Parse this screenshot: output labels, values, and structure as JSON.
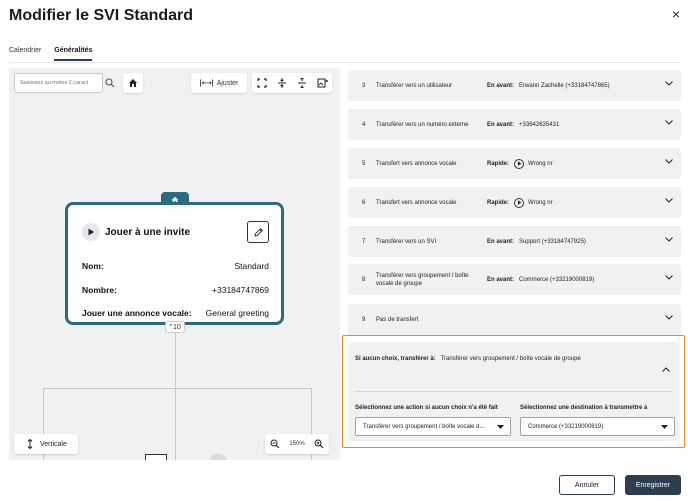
{
  "header": {
    "title": "Modifier le SVI Standard",
    "close_symbol": "×"
  },
  "tabs": [
    {
      "label": "Calendrier",
      "active": false
    },
    {
      "label": "Généralités",
      "active": true
    }
  ],
  "canvas": {
    "search_placeholder": "Saisissez au moins 2 caract",
    "toolbar": {
      "fit_label": "Ajuster"
    },
    "node": {
      "title": "Jouer à une invite",
      "rows": [
        {
          "key": "Nom:",
          "value": "Standard"
        },
        {
          "key": "Nombre:",
          "value": "+33184747869"
        },
        {
          "key": "Jouer une annonce vocale:",
          "value": "General greeting"
        }
      ],
      "children_count": "10"
    },
    "orientation_label": "Verticale",
    "zoom_level": "150%"
  },
  "options": [
    {
      "num": "3",
      "label": "Transférer vers un utilisateur",
      "mode": "En avant:",
      "dest": "Erwann Zachelle (+33184747865)",
      "has_play": false
    },
    {
      "num": "4",
      "label": "Transférer vers un numéro externe",
      "mode": "En avant:",
      "dest": "+33642635431",
      "has_play": false
    },
    {
      "num": "5",
      "label": "Transfert vers annonce vocale",
      "mode": "Rapide:",
      "dest": "Wrong nr",
      "has_play": true
    },
    {
      "num": "6",
      "label": "Transfert vers annonce vocale",
      "mode": "Rapide:",
      "dest": "Wrong nr",
      "has_play": true
    },
    {
      "num": "7",
      "label": "Transférer vers un SVI",
      "mode": "En avant:",
      "dest": "Support (+33184747925)",
      "has_play": false
    },
    {
      "num": "8",
      "label": "Transférer vers groupement / boîte vocale de groupe",
      "mode": "En avant:",
      "dest": "Commerce (+33219000819)",
      "has_play": false
    },
    {
      "num": "9",
      "label": "Pas de transfert",
      "mode": "",
      "dest": "",
      "has_play": false
    }
  ],
  "no_choice": {
    "heading_label": "Si aucun choix, transférer à:",
    "heading_value": "Transférer vers groupement / boîte vocale de groupe",
    "action_label": "Sélectionnez une action si aucun choix n'a été fait",
    "action_value": "Transférer vers groupement / boîte vocale d...",
    "destination_label": "Sélectionnez une destination à transmettre à",
    "destination_value": "Commerce (+33219000819)"
  },
  "footer": {
    "cancel_label": "Annuler",
    "save_label": "Enregistrer"
  },
  "colors": {
    "node_border": "#2a6b81",
    "highlight": "#e8891e",
    "primary_button": "#2d3e50"
  }
}
